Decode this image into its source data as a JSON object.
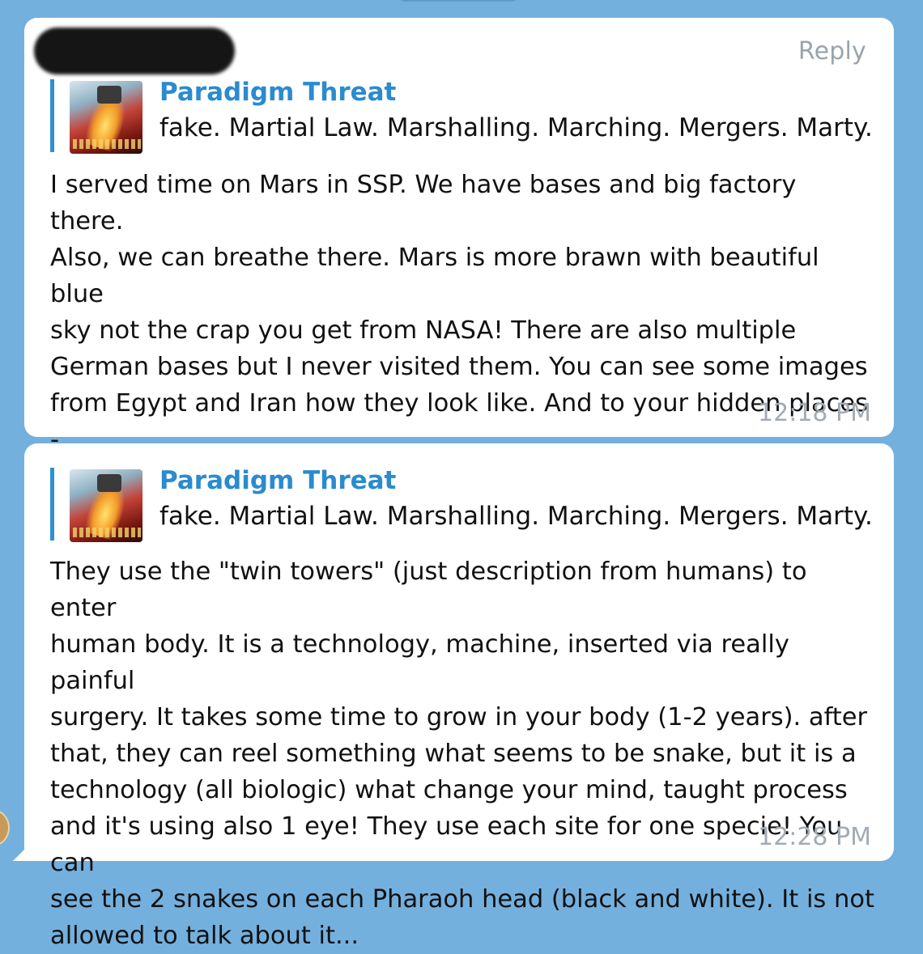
{
  "chat": {
    "messages": [
      {
        "reply_label": "Reply",
        "quote": {
          "name": "Paradigm Threat",
          "text": "fake. Martial Law. Marshalling. Marching. Mergers. Marty..."
        },
        "text": "I served time on Mars in SSP. We have bases and big factory there.\nAlso, we can breathe there. Mars is more brawn with beautiful blue\nsky not the crap you get from NASA! There are also multiple\nGerman bases but I never visited them. You can see some images\nfrom Egypt and Iran how they look like. And to your hidden places -\nunderground, moon and some of them on Mars, but not so many.\nDon't ask more...",
        "time": "12:18 PM"
      },
      {
        "quote": {
          "name": "Paradigm Threat",
          "text": "fake. Martial Law. Marshalling. Marching. Mergers. Marty..."
        },
        "text": "They use the \"twin towers\" (just description from humans) to enter\nhuman body. It is a technology, machine, inserted via really painful\nsurgery. It takes some time to grow in your body (1-2 years). after\nthat, they can reel something what seems to be snake, but it is a\ntechnology (all biologic) what change your mind, taught process\nand it's using also 1 eye! They use each site for one specie! You can\nsee the 2 snakes on each Pharaoh head (black and white). It is not\nallowed to talk about it...",
        "time": "12:28 PM"
      }
    ]
  },
  "colors": {
    "background": "#74b0de",
    "bubble": "#ffffff",
    "accent": "#2a8bcf",
    "timestamp": "#a3abb3"
  }
}
